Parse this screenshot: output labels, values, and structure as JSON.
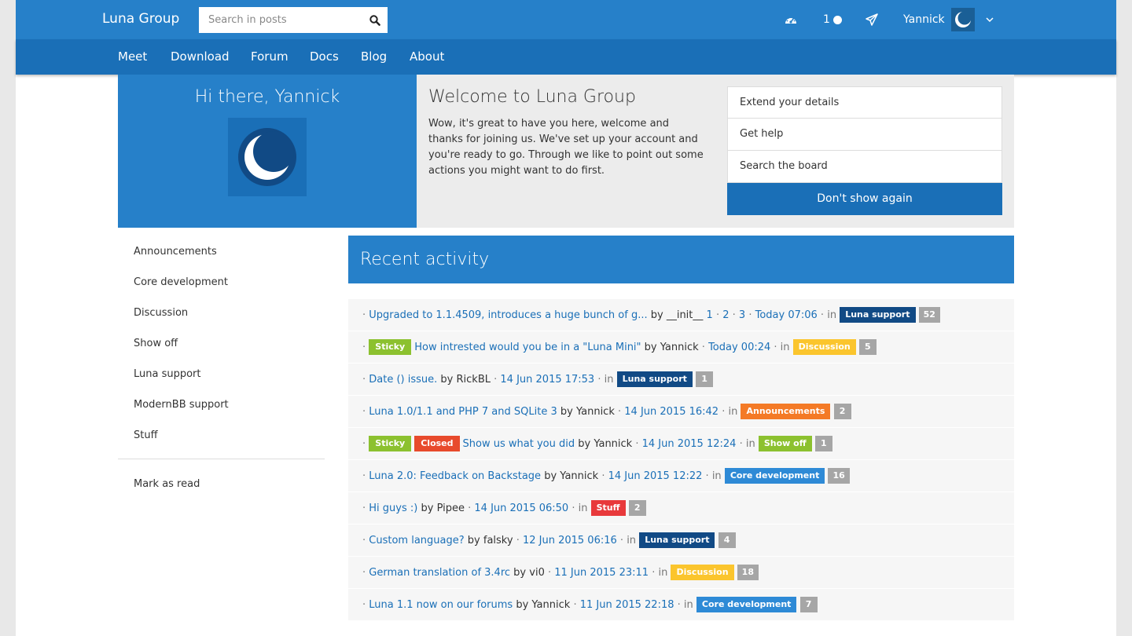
{
  "brand": "Luna Group",
  "search": {
    "placeholder": "Search in posts"
  },
  "topbar": {
    "notif_count": "1",
    "user_name": "Yannick"
  },
  "nav": [
    "Meet",
    "Download",
    "Forum",
    "Docs",
    "Blog",
    "About"
  ],
  "hero": {
    "greeting": "Hi there, Yannick",
    "title": "Welcome to Luna Group",
    "text": "Wow, it's great to have you here, welcome and thanks for joining us. We've set up your account and you're ready to go. Through we like to point out some actions you might want to do first.",
    "actions": [
      "Extend your details",
      "Get help",
      "Search the board"
    ],
    "dont_show": "Don't show again"
  },
  "sidebar": {
    "items": [
      "Announcements",
      "Core development",
      "Discussion",
      "Show off",
      "Luna support",
      "ModernBB support",
      "Stuff"
    ],
    "mark_read": "Mark as read"
  },
  "recent": {
    "title": "Recent activity",
    "labels": {
      "sticky": "Sticky",
      "closed": "Closed",
      "by": "by",
      "in": "in"
    },
    "rows": [
      {
        "sticky": false,
        "closed": false,
        "title": "Upgraded to 1.1.4509, introduces a huge bunch of g...",
        "author": "__init__",
        "pages": [
          "1",
          "2",
          "3"
        ],
        "date": "Today 07:06",
        "forum": "Luna support",
        "count": "52"
      },
      {
        "sticky": true,
        "closed": false,
        "title": "How intrested would you be in a \"Luna Mini\"",
        "author": "Yannick",
        "pages": [],
        "date": "Today 00:24",
        "forum": "Discussion",
        "count": "5"
      },
      {
        "sticky": false,
        "closed": false,
        "title": "Date () issue.",
        "author": "RickBL",
        "pages": [],
        "date": "14 Jun 2015 17:53",
        "forum": "Luna support",
        "count": "1"
      },
      {
        "sticky": false,
        "closed": false,
        "title": "Luna 1.0/1.1 and PHP 7 and SQLite 3",
        "author": "Yannick",
        "pages": [],
        "date": "14 Jun 2015 16:42",
        "forum": "Announcements",
        "count": "2"
      },
      {
        "sticky": true,
        "closed": true,
        "title": "Show us what you did",
        "author": "Yannick",
        "pages": [],
        "date": "14 Jun 2015 12:24",
        "forum": "Show off",
        "count": "1"
      },
      {
        "sticky": false,
        "closed": false,
        "title": "Luna 2.0: Feedback on Backstage",
        "author": "Yannick",
        "pages": [],
        "date": "14 Jun 2015 12:22",
        "forum": "Core development",
        "count": "16"
      },
      {
        "sticky": false,
        "closed": false,
        "title": "Hi guys :)",
        "author": "Pipee",
        "pages": [],
        "date": "14 Jun 2015 06:50",
        "forum": "Stuff",
        "count": "2"
      },
      {
        "sticky": false,
        "closed": false,
        "title": "Custom language?",
        "author": "falsky",
        "pages": [],
        "date": "12 Jun 2015 06:16",
        "forum": "Luna support",
        "count": "4"
      },
      {
        "sticky": false,
        "closed": false,
        "title": "German translation of 3.4rc",
        "author": "vi0",
        "pages": [],
        "date": "11 Jun 2015 23:11",
        "forum": "Discussion",
        "count": "18"
      },
      {
        "sticky": false,
        "closed": false,
        "title": "Luna 1.1 now on our forums",
        "author": "Yannick",
        "pages": [],
        "date": "11 Jun 2015 22:18",
        "forum": "Core development",
        "count": "7"
      }
    ]
  },
  "colors": {
    "primary": "#2680c9",
    "primary_dark": "#1a6fb7",
    "sticky": "#8cc12f",
    "closed": "#e84a2c",
    "forums": {
      "Luna support": "#114a85",
      "Discussion": "#fbc52d",
      "Announcements": "#f47a26",
      "Show off": "#8cc12f",
      "Core development": "#2e8ad6",
      "Stuff": "#e8393b"
    }
  },
  "icons": [
    "search-icon",
    "dashboard-icon",
    "send-icon",
    "chevron-down-icon",
    "luna-logo-icon"
  ]
}
